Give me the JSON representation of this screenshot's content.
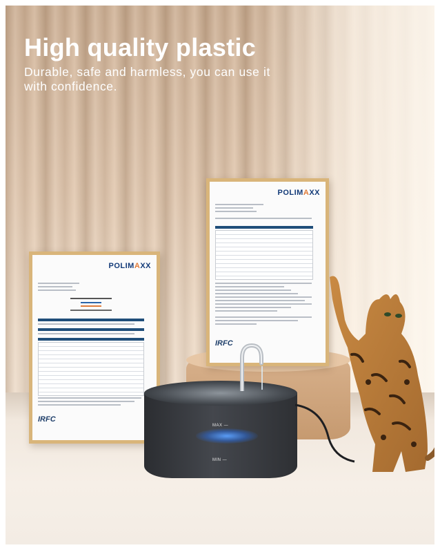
{
  "headline": "High quality plastic",
  "subtitle": "Durable, safe and harmless, you can use it with confidence.",
  "certificates": {
    "brand": "POLIMAXX",
    "brand_pre": "POLIM",
    "brand_accent": "A",
    "brand_post": "XX",
    "issuer": "IRFC"
  },
  "fountain": {
    "max_label": "MAX —",
    "min_label": "MIN —"
  }
}
